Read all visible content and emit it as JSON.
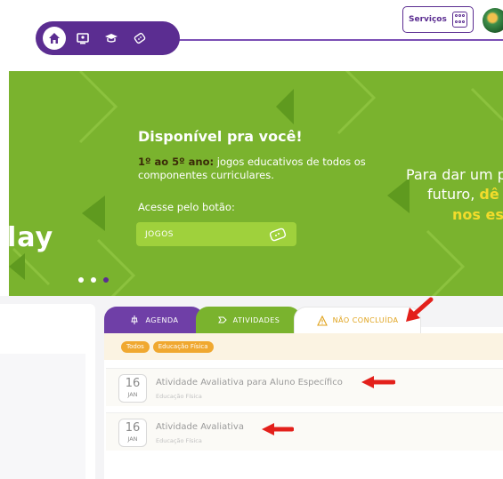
{
  "header": {
    "nav_icons": [
      "home-icon",
      "monitor-icon",
      "graduation-cap-icon",
      "ticket-icon"
    ],
    "services_label": "Serviços"
  },
  "banner": {
    "left_fragment": "lay",
    "title": "Disponível pra você!",
    "desc_bold": "1º ao 5º ano:",
    "desc_rest": " jogos educativos de todos os componentes curriculares.",
    "access_text": "Acesse pelo botão:",
    "games_button": "JOGOS",
    "right_line1": "Para dar um p",
    "right_line2_a": "futuro, ",
    "right_line2_b": "dê",
    "right_line3": "nos es"
  },
  "tabs": [
    {
      "label": "AGENDA",
      "icon": "pin-icon"
    },
    {
      "label": "ATIVIDADES",
      "icon": "puzzle-icon"
    },
    {
      "label": "NÃO CONCLUÍDA",
      "icon": "warning-icon"
    }
  ],
  "filters": [
    "Todos",
    "Educação Física"
  ],
  "activities": [
    {
      "day": "16",
      "month": "JAN",
      "title": "Atividade Avaliativa para Aluno Específico",
      "subject": "Educação Física"
    },
    {
      "day": "16",
      "month": "JAN",
      "title": "Atividade Avaliativa",
      "subject": "Educação Física"
    }
  ],
  "colors": {
    "brand_purple": "#5b2d91",
    "banner_green": "#7ab32e",
    "accent_yellow": "#f2dc2b",
    "warning_orange": "#f0a830",
    "annotation_red": "#e3201b"
  }
}
